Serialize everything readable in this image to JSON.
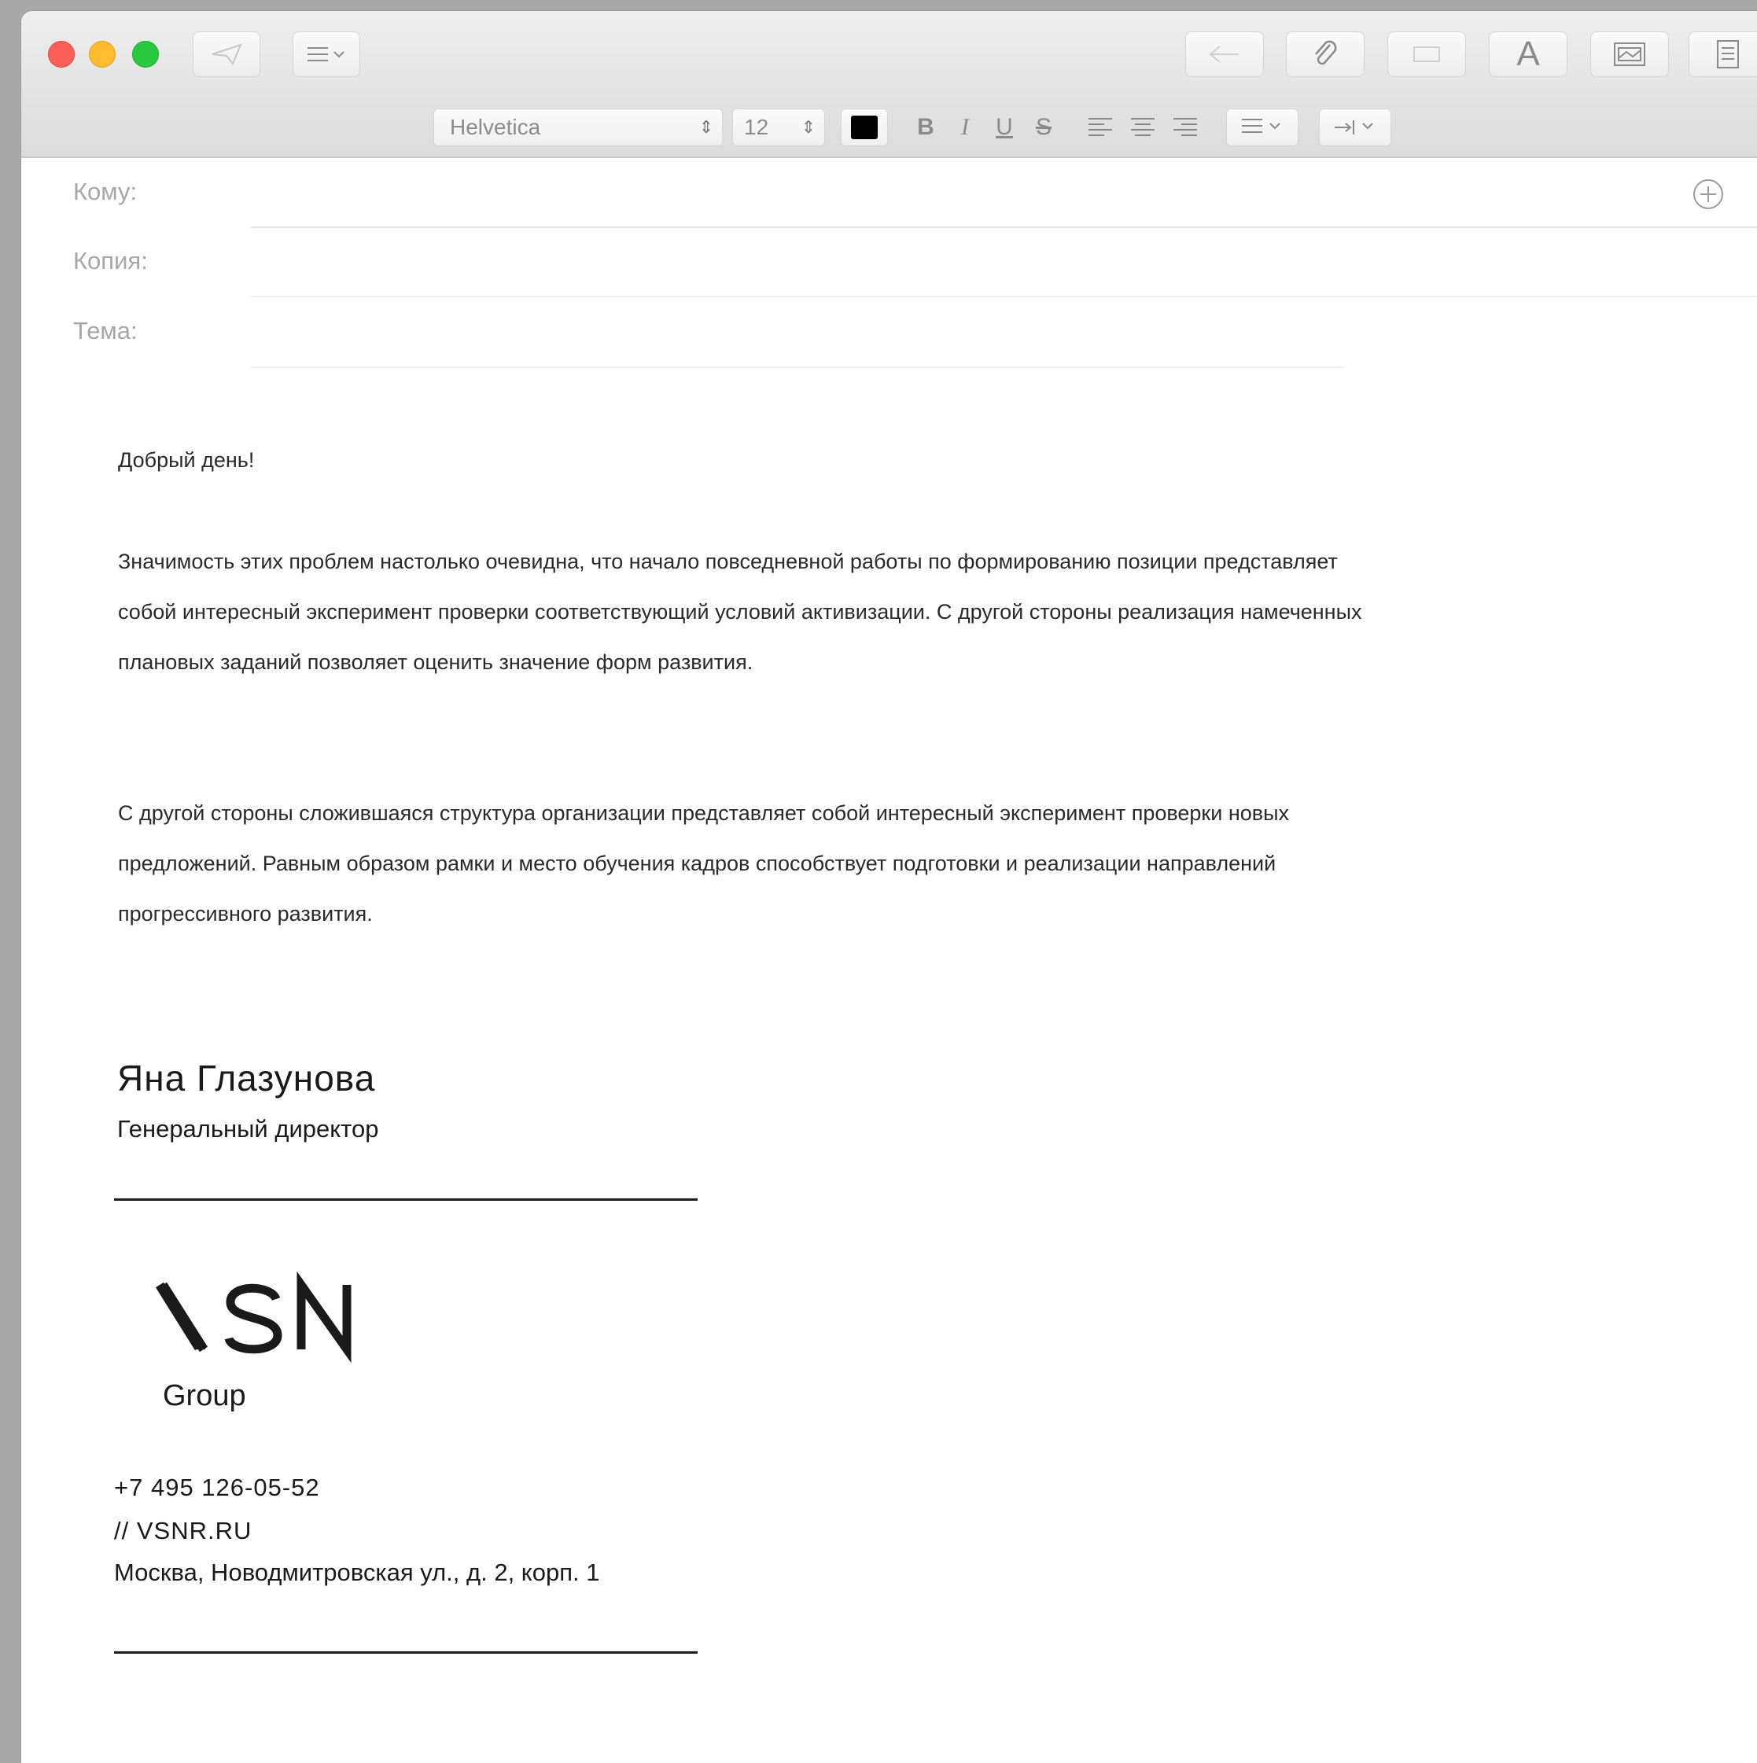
{
  "toolbar": {
    "font_name": "Helvetica",
    "font_size": "12",
    "text_color": "#000000",
    "bold_label": "B",
    "italic_label": "I",
    "underline_label": "U",
    "strike_label": "S",
    "font_button_label": "A"
  },
  "header": {
    "to_label": "Кому:",
    "cc_label": "Копия:",
    "subject_label": "Тема:"
  },
  "body": {
    "greeting": "Добрый день!",
    "paragraph1": "Значимость этих проблем настолько очевидна, что начало повседневной работы по формированию позиции представляет собой интересный эксперимент проверки соответствующий условий активизации. С другой стороны реализация намеченных плановых заданий позволяет оценить значение форм развития.",
    "paragraph2": "С другой стороны сложившаяся структура организации представляет собой интересный эксперимент проверки новых предложений. Равным образом рамки и место обучения кадров способствует подготовки и реализации направлений прогрессивного развития."
  },
  "signature": {
    "name": "Яна Глазунова",
    "title": "Генеральный директор",
    "logo_text": "VSN",
    "logo_sub": "Group",
    "phone": "+7 495 126-05-52",
    "website": "//  VSNR.RU",
    "address": "Москва, Новодмитровская ул., д. 2, корп. 1"
  }
}
